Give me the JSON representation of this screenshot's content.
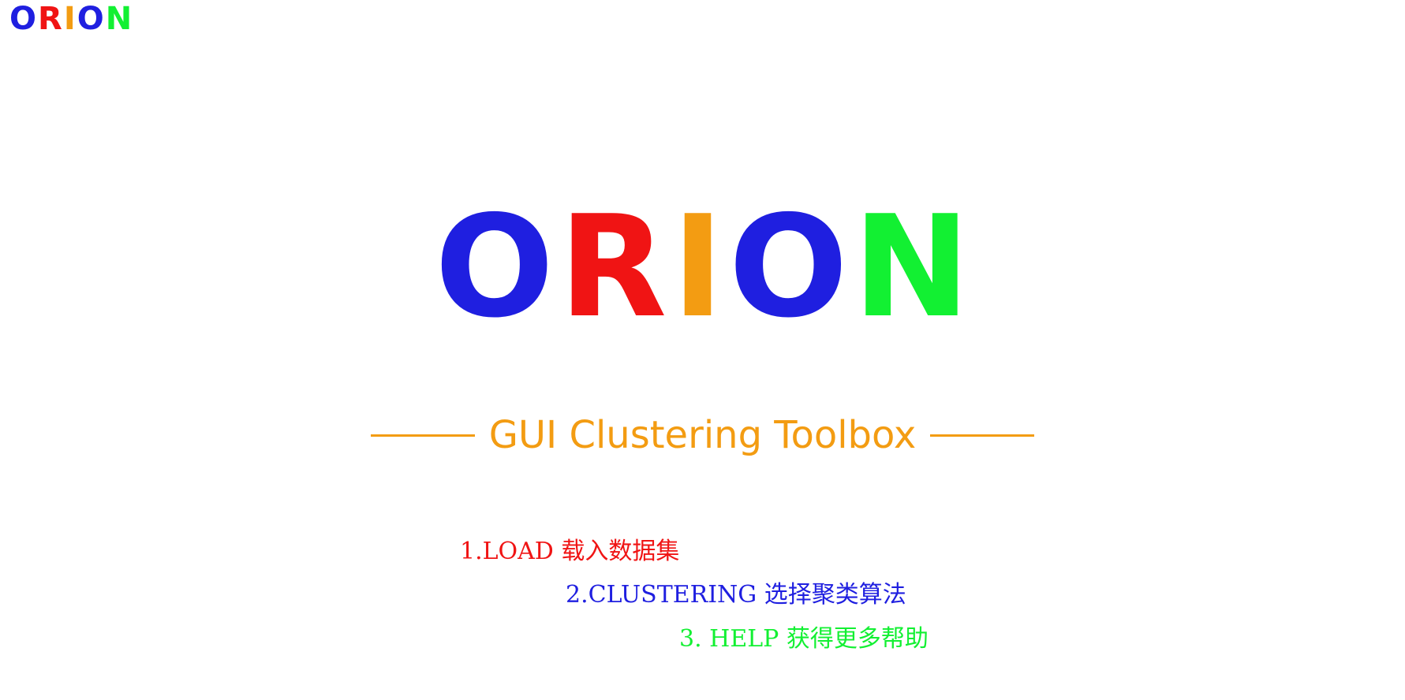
{
  "mini_logo": {
    "letters": [
      "O",
      "R",
      "I",
      "O",
      "N"
    ]
  },
  "hero_logo": {
    "letters": [
      "O",
      "R",
      "I",
      "O",
      "N"
    ]
  },
  "tagline": {
    "text": "GUI Clustering Toolbox"
  },
  "steps": {
    "load": "1.LOAD 载入数据集",
    "clustering": "2.CLUSTERING 选择聚类算法",
    "help": "3. HELP 获得更多帮助"
  },
  "colors": {
    "blue": "#1f1fe0",
    "red": "#f01414",
    "orange": "#f39c12",
    "green": "#12f032"
  }
}
